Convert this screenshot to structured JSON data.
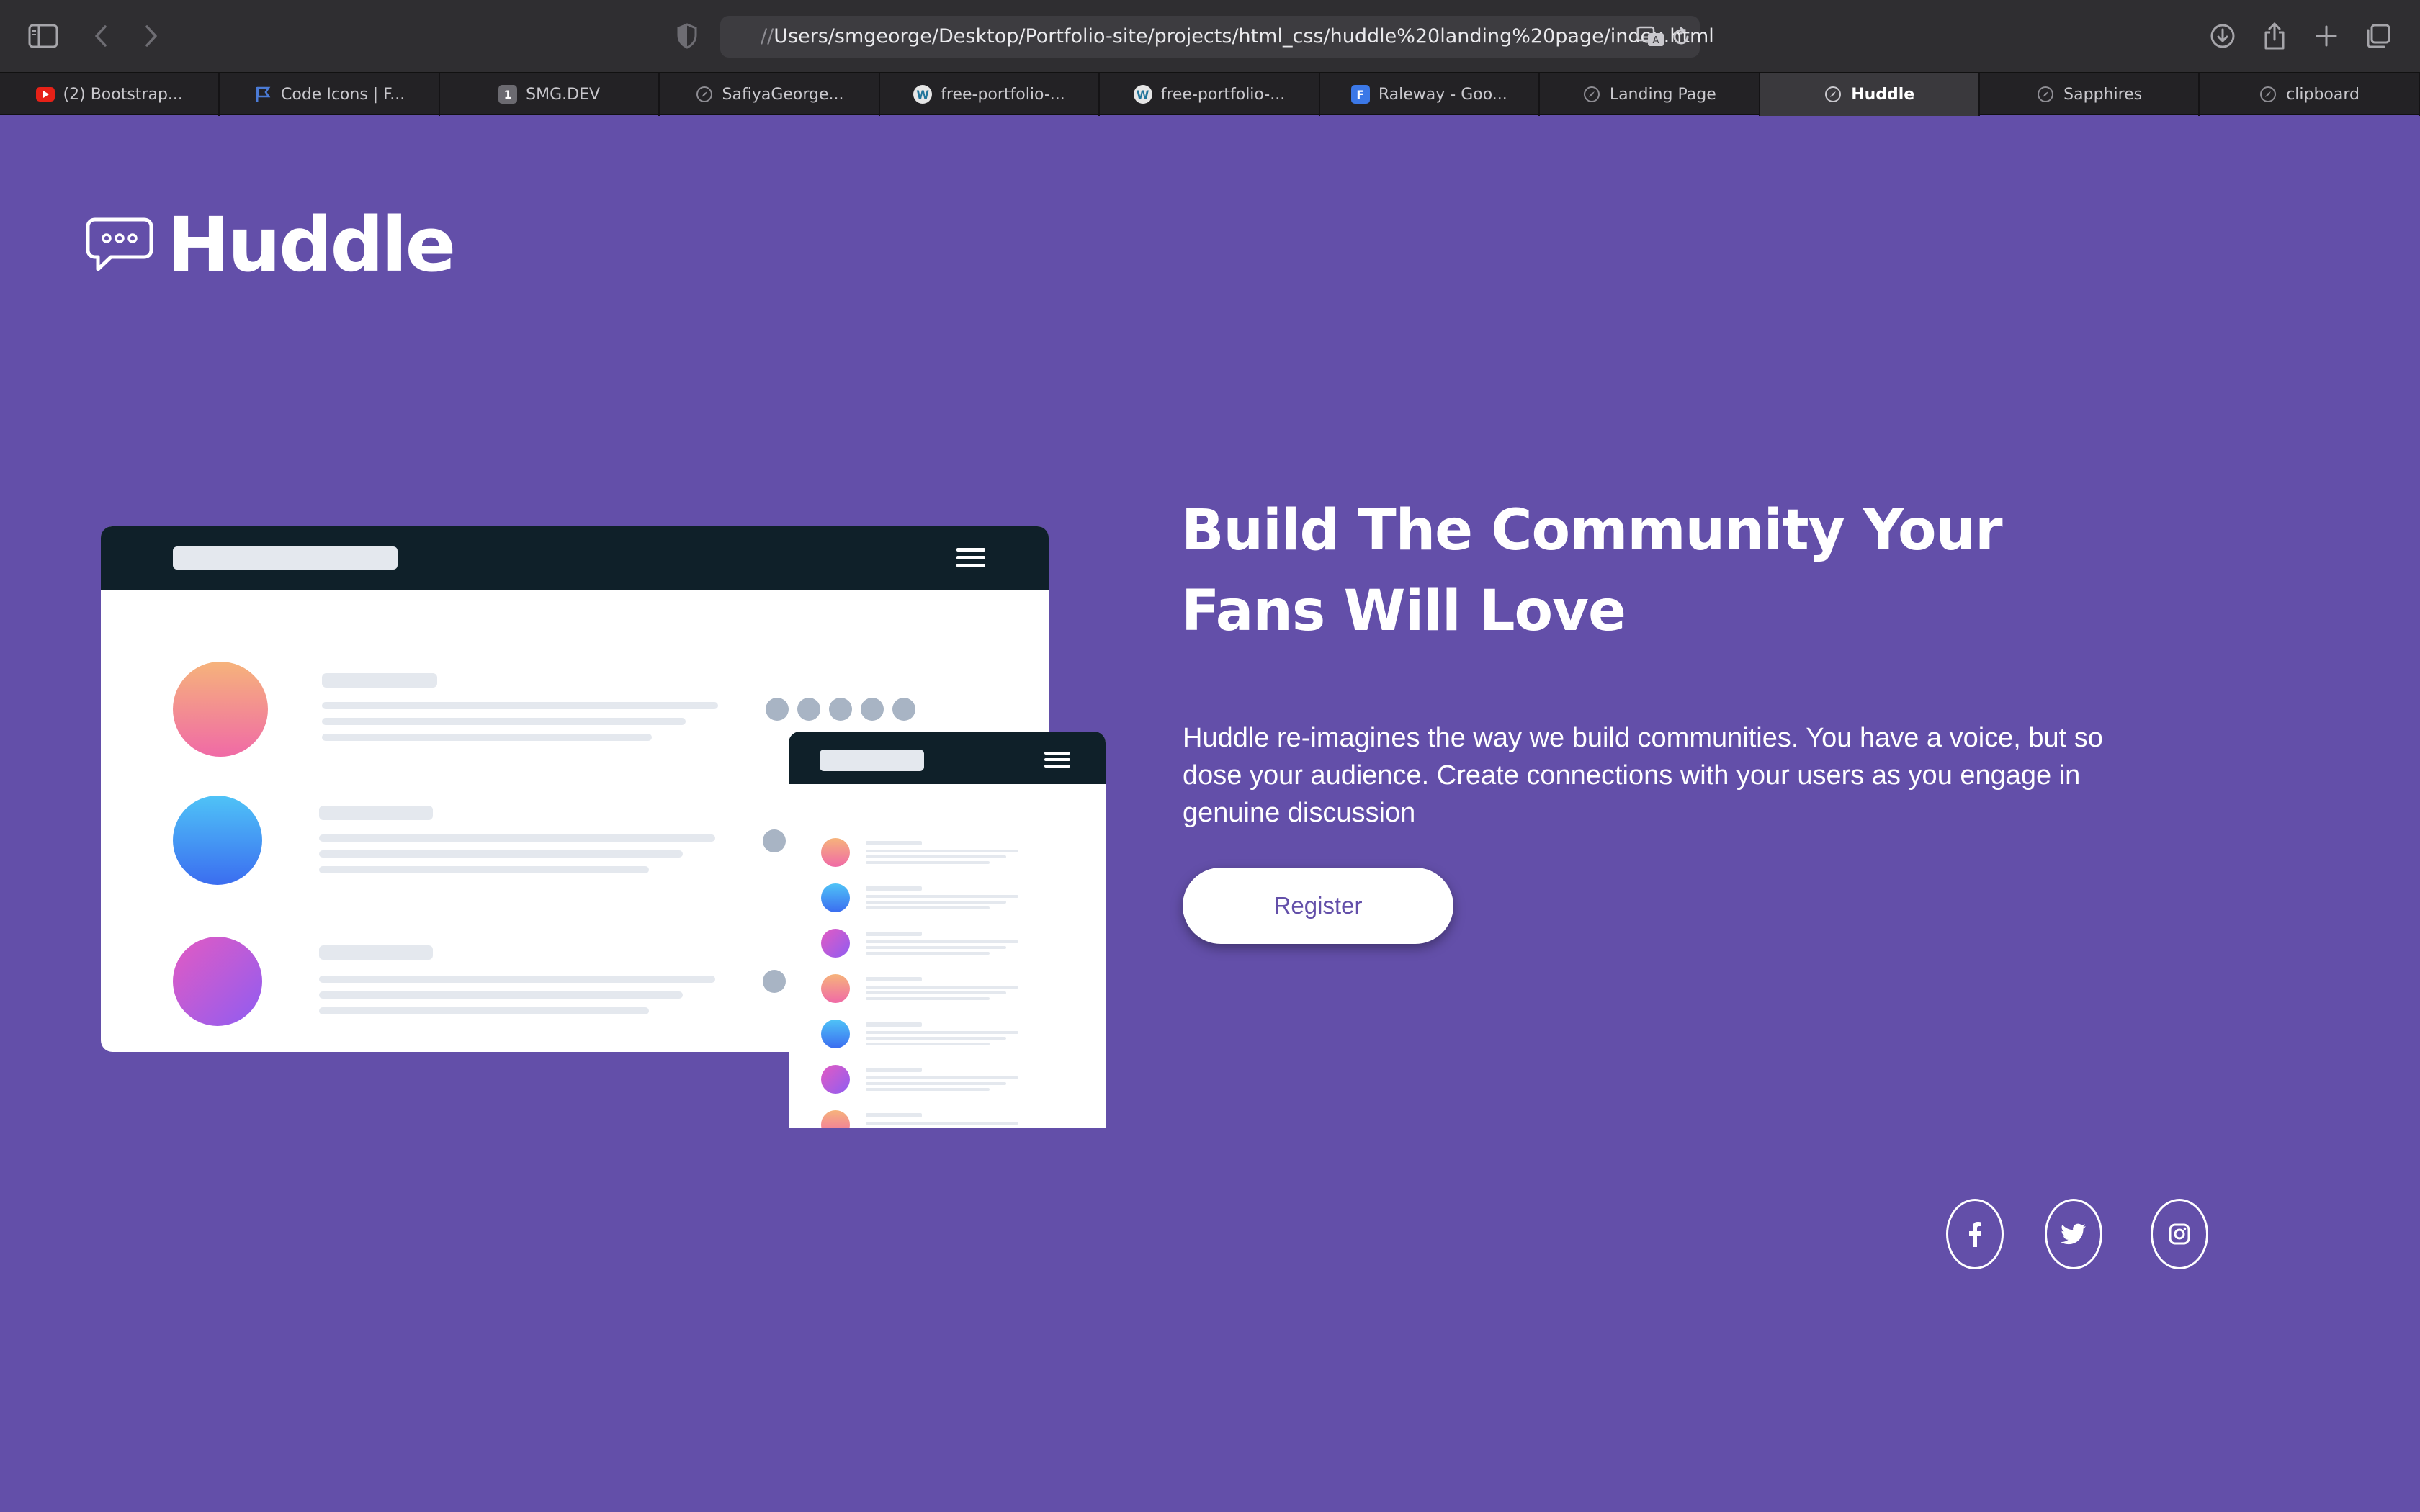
{
  "browser": {
    "url_prefix": "//",
    "url": "Users/smgeorge/Desktop/Portfolio-site/projects/html_css/huddle%20landing%20page/index.html",
    "tabs": [
      {
        "label": "(2) Bootstrap...",
        "icon": "youtube-icon",
        "color": "#e62117",
        "active": false
      },
      {
        "label": "Code Icons | F...",
        "icon": "flag-icon",
        "color": "#4b7bd6",
        "active": false
      },
      {
        "label": "SMG.DEV",
        "icon": "number-one-icon",
        "glyph": "1",
        "color": "#6b6a70",
        "active": false
      },
      {
        "label": "SafiyaGeorge...",
        "icon": "compass-icon",
        "color": "#8e8d93",
        "active": false
      },
      {
        "label": "free-portfolio-...",
        "icon": "wordpress-icon",
        "color": "#e6e6e6",
        "active": false
      },
      {
        "label": "free-portfolio-...",
        "icon": "wordpress-icon",
        "color": "#e6e6e6",
        "active": false
      },
      {
        "label": "Raleway - Goo...",
        "icon": "font-f-icon",
        "glyph": "F",
        "color": "#3b78e7",
        "active": false
      },
      {
        "label": "Landing Page",
        "icon": "compass-icon",
        "color": "#8e8d93",
        "active": false
      },
      {
        "label": "Huddle",
        "icon": "compass-icon",
        "color": "#c9c8cd",
        "active": true
      },
      {
        "label": "Sapphires",
        "icon": "compass-icon",
        "color": "#8e8d93",
        "active": false
      },
      {
        "label": "clipboard",
        "icon": "compass-icon",
        "color": "#8e8d93",
        "active": false
      }
    ]
  },
  "page": {
    "logo_text": "Huddle",
    "hero": {
      "title": "Build The Community Your Fans Will Love",
      "description": "Huddle re-imagines the way we build communities. You have a voice, but so dose your audience. Create connections with your users as you engage in genuine discussion",
      "register_label": "Register"
    },
    "social": [
      {
        "icon": "facebook-icon"
      },
      {
        "icon": "twitter-icon"
      },
      {
        "icon": "instagram-icon"
      }
    ],
    "colors": {
      "background": "#634fa9",
      "mock_header": "#0f2029",
      "button_text": "#634fa9"
    }
  }
}
